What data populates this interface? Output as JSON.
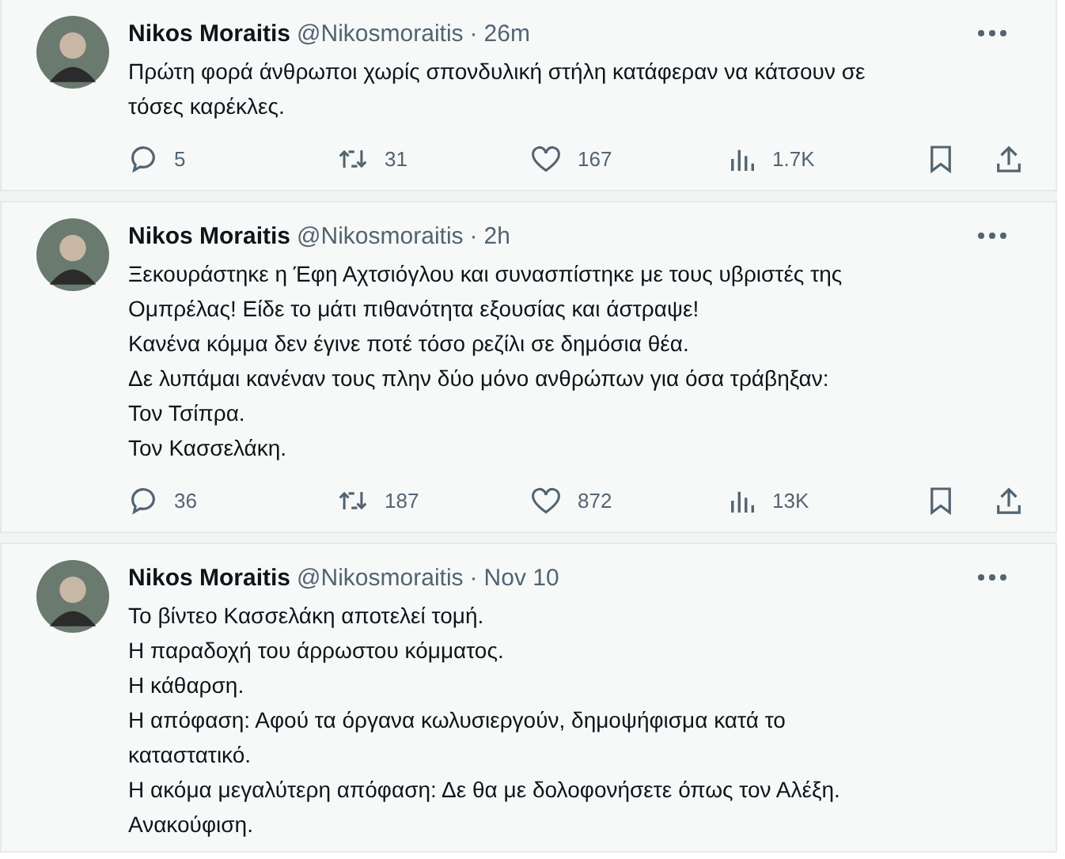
{
  "tweets": [
    {
      "name": "Nikos Moraitis",
      "handle": "@Nikosmoraitis",
      "sep": "·",
      "time": "26m",
      "text": "Πρώτη φορά άνθρωποι χωρίς σπονδυλική στήλη κατάφεραν να κάτσουν σε τόσες καρέκλες.",
      "replies": "5",
      "retweets": "31",
      "likes": "167",
      "views": "1.7K"
    },
    {
      "name": "Nikos Moraitis",
      "handle": "@Nikosmoraitis",
      "sep": "·",
      "time": "2h",
      "text": "Ξεκουράστηκε η Έφη Αχτσιόγλου και συνασπίστηκε με τους υβριστές της Ομπρέλας! Είδε το μάτι πιθανότητα εξουσίας και άστραψε!\nΚανένα κόμμα δεν έγινε ποτέ τόσο ρεζίλι σε δημόσια θέα.\nΔε λυπάμαι κανέναν τους πλην δύο μόνο ανθρώπων για όσα τράβηξαν:\nΤον Τσίπρα.\nΤον Κασσελάκη.",
      "replies": "36",
      "retweets": "187",
      "likes": "872",
      "views": "13K"
    },
    {
      "name": "Nikos Moraitis",
      "handle": "@Nikosmoraitis",
      "sep": "·",
      "time": "Nov 10",
      "text": "Το βίντεο Κασσελάκη αποτελεί τομή.\nΗ παραδοχή του άρρωστου κόμματος.\nΗ κάθαρση.\nΗ απόφαση: Αφού τα όργανα κωλυσιεργούν, δημοψήφισμα κατά το καταστατικό.\nΗ ακόμα μεγαλύτερη απόφαση: Δε θα με δολοφονήσετε όπως τον Αλέξη.\nΑνακούφιση."
    }
  ]
}
